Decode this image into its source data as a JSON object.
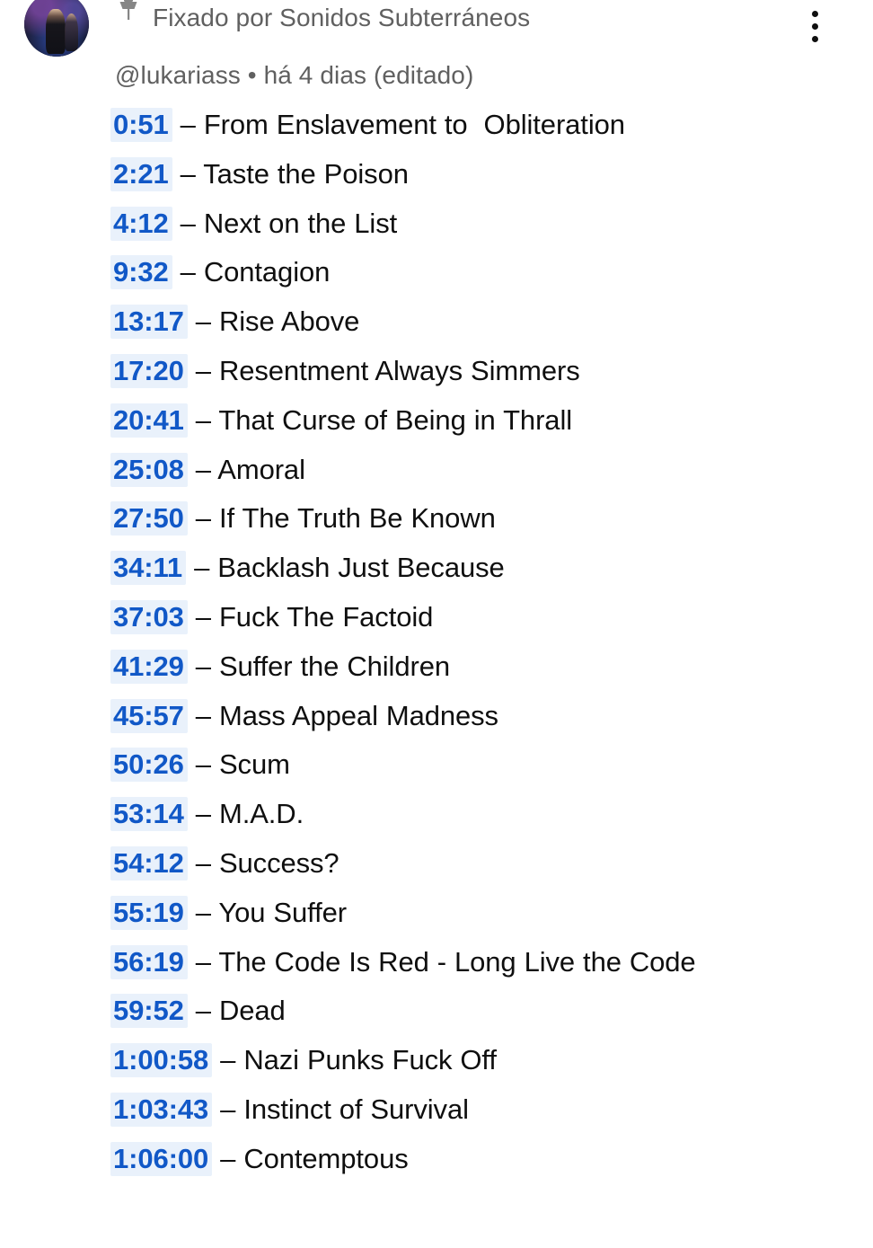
{
  "comment": {
    "pinned_label": "Fixado por Sonidos Subterráneos",
    "pin_icon": "pin-icon",
    "author_line": "@lukariass • há 4 dias (editado)",
    "author_handle": "@lukariass",
    "time_ago": "há 4 dias",
    "edited_label": "(editado)",
    "overflow_icon": "more-vertical-icon",
    "avatar_alt": "avatar",
    "separator": " – ",
    "link_color": "#1158c7",
    "link_highlight": "#e9f1fb",
    "text_color": "#0f0f0f",
    "meta_color": "#606060"
  },
  "timestamps": [
    {
      "time": "0:51",
      "title": "From Enslavement to  Obliteration"
    },
    {
      "time": "2:21",
      "title": "Taste the Poison"
    },
    {
      "time": "4:12",
      "title": "Next on the List"
    },
    {
      "time": "9:32",
      "title": "Contagion"
    },
    {
      "time": "13:17",
      "title": "Rise Above"
    },
    {
      "time": "17:20",
      "title": "Resentment Always Simmers"
    },
    {
      "time": "20:41",
      "title": "That Curse of Being in Thrall"
    },
    {
      "time": "25:08",
      "title": "Amoral"
    },
    {
      "time": "27:50",
      "title": "If The Truth Be Known"
    },
    {
      "time": "34:11",
      "title": "Backlash Just Because"
    },
    {
      "time": "37:03",
      "title": "Fuck The Factoid"
    },
    {
      "time": "41:29",
      "title": "Suffer the Children"
    },
    {
      "time": "45:57",
      "title": "Mass Appeal Madness"
    },
    {
      "time": "50:26",
      "title": "Scum"
    },
    {
      "time": "53:14",
      "title": "M.A.D."
    },
    {
      "time": "54:12",
      "title": "Success?"
    },
    {
      "time": "55:19",
      "title": "You Suffer"
    },
    {
      "time": "56:19",
      "title": "The Code Is Red - Long Live the Code"
    },
    {
      "time": "59:52",
      "title": "Dead"
    },
    {
      "time": "1:00:58",
      "title": "Nazi Punks Fuck Off"
    },
    {
      "time": "1:03:43",
      "title": "Instinct of Survival"
    },
    {
      "time": "1:06:00",
      "title": "Contemptous"
    }
  ]
}
